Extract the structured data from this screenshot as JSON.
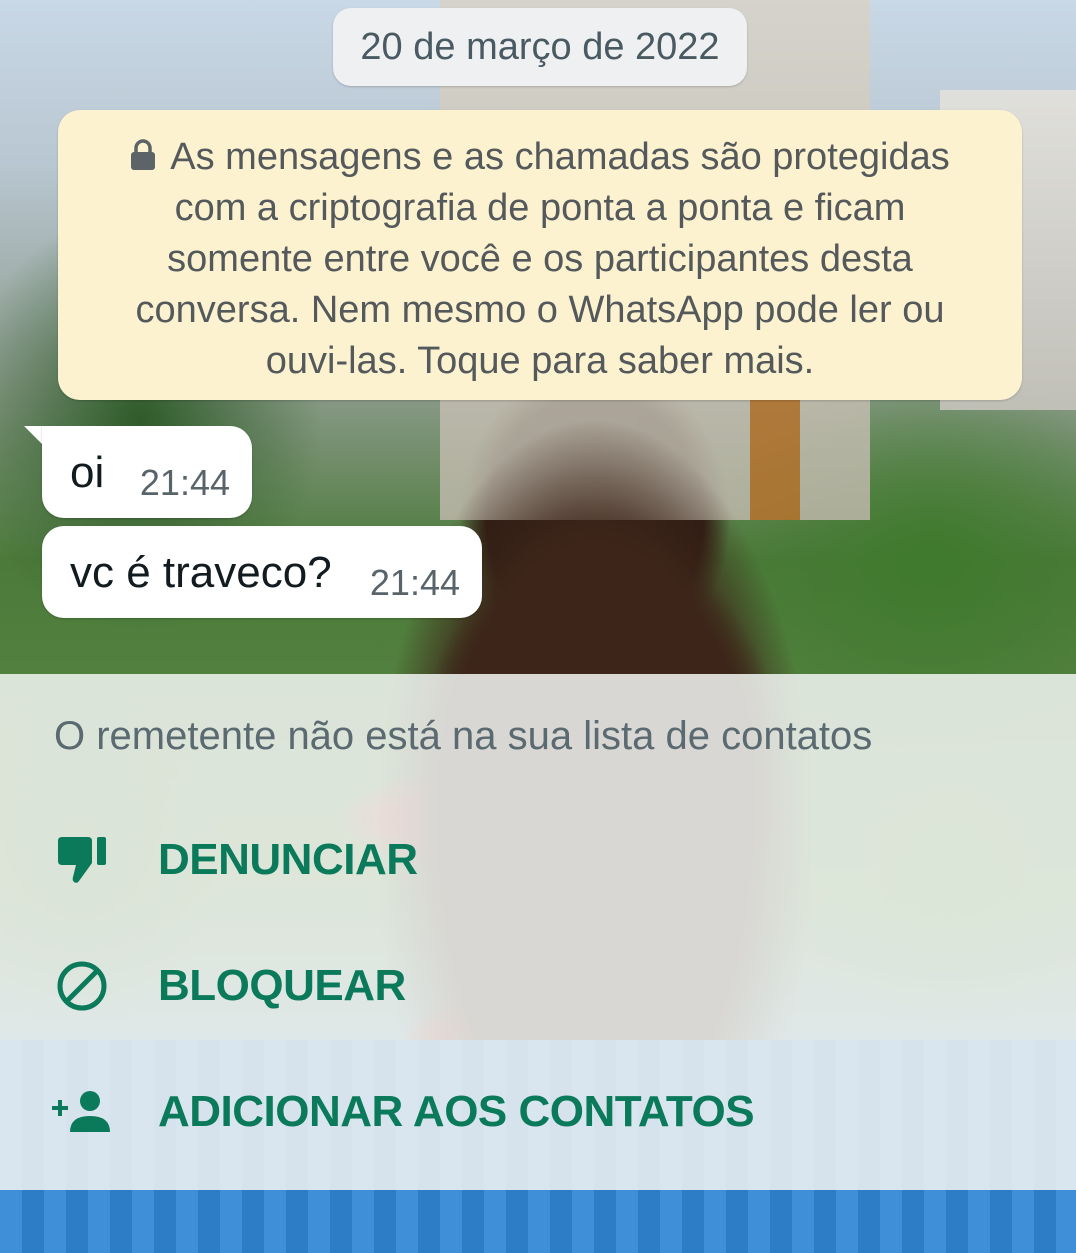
{
  "chat": {
    "date_chip": "20 de março de 2022",
    "encryption_notice": {
      "lines": [
        "As mensagens e as chamadas são protegidas",
        "com a criptografia de ponta a ponta e ficam",
        "somente entre você e os participantes desta",
        "conversa. Nem mesmo o WhatsApp pode ler ou",
        "ouvi-las. Toque para saber mais."
      ],
      "icon": "lock-icon"
    },
    "messages": [
      {
        "text": "oi",
        "time": "21:44"
      },
      {
        "text": "vc é traveco?",
        "time": "21:44"
      }
    ]
  },
  "unknown_sender": {
    "title": "O remetente não está na sua lista de contatos",
    "actions": [
      {
        "label": "DENUNCIAR",
        "icon": "thumbs-down-icon"
      },
      {
        "label": "BLOQUEAR",
        "icon": "block-icon"
      },
      {
        "label": "ADICIONAR AOS CONTATOS",
        "icon": "add-person-icon"
      }
    ]
  },
  "colors": {
    "action_text": "#0b7a5a",
    "notice_bg": "#fdf2cf",
    "bubble_bg": "#ffffff"
  }
}
